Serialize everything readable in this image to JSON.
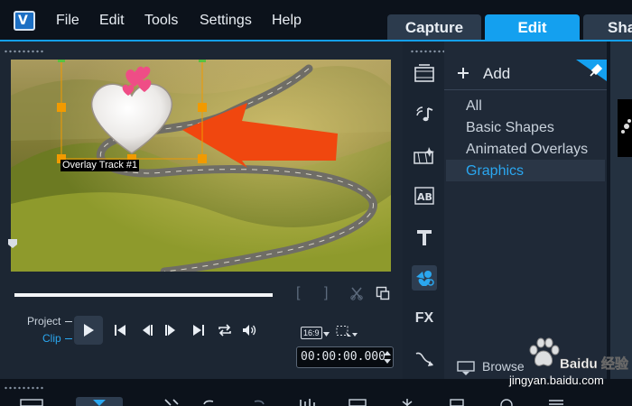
{
  "menu": {
    "items": [
      "File",
      "Edit",
      "Tools",
      "Settings",
      "Help"
    ]
  },
  "tabs": [
    "Capture",
    "Edit",
    "Sha"
  ],
  "player": {
    "overlay_label": "Overlay Track #1",
    "project_label": "Project",
    "clip_label": "Clip",
    "mark_in": "[",
    "mark_out": "]",
    "aspect_ratio": "16:9",
    "timecode": "00:00:00.000"
  },
  "library": {
    "add_label": "Add",
    "categories": [
      "All",
      "Basic Shapes",
      "Animated Overlays",
      "Graphics"
    ],
    "selected_category": "Graphics",
    "browse_label": "Browse",
    "strip_icons": [
      "media-icon",
      "audio-icon",
      "transition-icon",
      "title-ab-icon",
      "title-t-icon",
      "graphics-icon",
      "fx-icon",
      "path-icon"
    ],
    "fx_label": "FX"
  },
  "watermark": {
    "line1": "Baidu 经验",
    "line2": "jingyan.baidu.com"
  },
  "colors": {
    "accent": "#14a0ef",
    "arrow": "#f0470f",
    "handle": "#f19a00"
  }
}
